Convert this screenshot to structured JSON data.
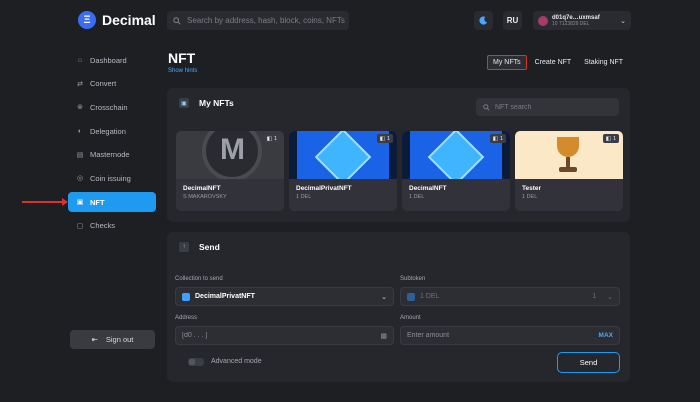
{
  "header": {
    "logo": "Decimal",
    "logo_mark": "Ξ",
    "search_placeholder": "Search by address, hash, block, coins, NFTs",
    "theme_icon": "moon-icon",
    "lang": "RU",
    "account": {
      "address": "d01q7e…uxmsaf",
      "balance": "10 7123829 DEL"
    }
  },
  "sidebar": {
    "items": [
      {
        "label": "Dashboard",
        "icon": "home-icon",
        "glyph": "⌂"
      },
      {
        "label": "Convert",
        "icon": "swap-icon",
        "glyph": "⇄"
      },
      {
        "label": "Crosschain",
        "icon": "link-icon",
        "glyph": "⊗"
      },
      {
        "label": "Delegation",
        "icon": "toggle-icon",
        "glyph": "◐"
      },
      {
        "label": "Masternode",
        "icon": "server-icon",
        "glyph": "▤"
      },
      {
        "label": "Coin issuing",
        "icon": "coin-icon",
        "glyph": "◎"
      },
      {
        "label": "NFT",
        "icon": "image-icon",
        "glyph": "▣",
        "active": true
      },
      {
        "label": "Checks",
        "icon": "check-doc-icon",
        "glyph": "▢"
      }
    ],
    "sign_out": "Sign out"
  },
  "page": {
    "title": "NFT",
    "show_hints": "Show hints",
    "tabs": [
      "My NFTs",
      "Create NFT",
      "Staking NFT"
    ],
    "active_tab": "My NFTs"
  },
  "my_nfts": {
    "title": "My NFTs",
    "search_placeholder": "NFT search",
    "cards": [
      {
        "name": "DecimalNFT",
        "sub": "S MAKAROVSKY",
        "count": "1",
        "image": "decimal-coin"
      },
      {
        "name": "DecimalPrivatNFT",
        "sub": "1 DEL",
        "count": "1",
        "image": "blue-cube"
      },
      {
        "name": "DecimalNFT",
        "sub": "1 DEL",
        "count": "1",
        "image": "blue-cube"
      },
      {
        "name": "Tester",
        "sub": "1 DEL",
        "count": "1",
        "image": "trophy"
      }
    ]
  },
  "send": {
    "title": "Send",
    "collection_label": "Collection to send",
    "collection_value": "DecimalPrivatNFT",
    "subtoken_label": "Subtoken",
    "subtoken_value": "1 DEL",
    "subtoken_qty": "1",
    "address_label": "Address",
    "address_placeholder": "[d0 . . . ]",
    "amount_label": "Amount",
    "amount_placeholder": "Enter amount",
    "max_label": "MAX",
    "advanced_mode": "Advanced mode",
    "send_button": "Send"
  },
  "colors": {
    "accent": "#1e9bf0",
    "highlight": "#d9342b",
    "background": "#1e1f23",
    "panel": "#26272c"
  }
}
